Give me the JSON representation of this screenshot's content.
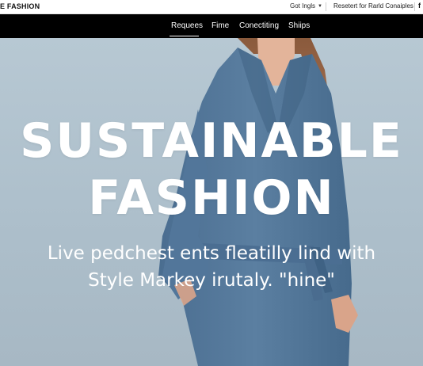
{
  "topbar": {
    "brand": "E FASHION",
    "language": "Got Ingls",
    "promo": "Resetert for Rarld Conaiples",
    "social": "f"
  },
  "nav": {
    "items": [
      "Requees",
      "Fime",
      "Conectiting",
      "Shiips"
    ],
    "active_index": 0
  },
  "hero": {
    "title_line1": "SUSTAINABLE",
    "title_line2": "FASHION",
    "subtitle_line1": "Live pedchest ents fleatilly lind with",
    "subtitle_line2": "Style Markey irutaly. \"hine\""
  },
  "colors": {
    "navbar_bg": "#000000",
    "hero_bg": "#b2c4cf",
    "coat": "#56799b"
  }
}
